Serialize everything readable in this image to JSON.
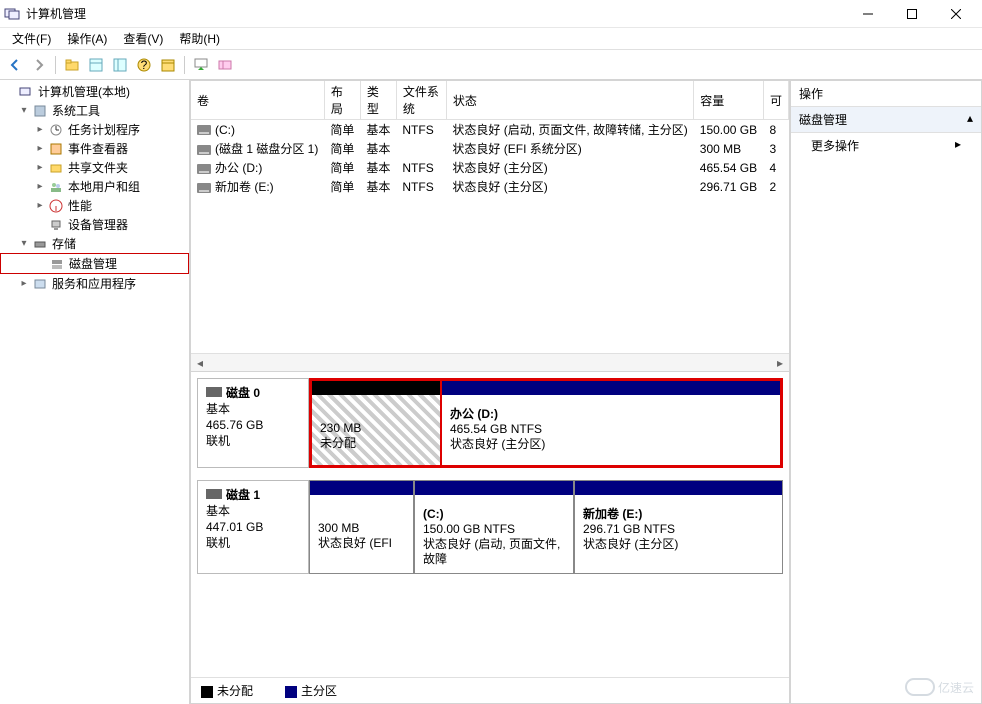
{
  "window": {
    "title": "计算机管理"
  },
  "menu": {
    "file": "文件(F)",
    "action": "操作(A)",
    "view": "查看(V)",
    "help": "帮助(H)"
  },
  "tree": {
    "root": "计算机管理(本地)",
    "system_tools": "系统工具",
    "task_scheduler": "任务计划程序",
    "event_viewer": "事件查看器",
    "shared_folders": "共享文件夹",
    "local_users": "本地用户和组",
    "performance": "性能",
    "device_manager": "设备管理器",
    "storage": "存储",
    "disk_management": "磁盘管理",
    "services_apps": "服务和应用程序"
  },
  "volumes": {
    "headers": {
      "volume": "卷",
      "layout": "布局",
      "type": "类型",
      "filesystem": "文件系统",
      "status": "状态",
      "capacity": "容量",
      "free": "可"
    },
    "rows": [
      {
        "name": "(C:)",
        "layout": "简单",
        "type": "基本",
        "fs": "NTFS",
        "status": "状态良好 (启动, 页面文件, 故障转储, 主分区)",
        "capacity": "150.00 GB",
        "free": "8"
      },
      {
        "name": "(磁盘 1 磁盘分区 1)",
        "layout": "简单",
        "type": "基本",
        "fs": "",
        "status": "状态良好 (EFI 系统分区)",
        "capacity": "300 MB",
        "free": "3"
      },
      {
        "name": "办公 (D:)",
        "layout": "简单",
        "type": "基本",
        "fs": "NTFS",
        "status": "状态良好 (主分区)",
        "capacity": "465.54 GB",
        "free": "4"
      },
      {
        "name": "新加卷 (E:)",
        "layout": "简单",
        "type": "基本",
        "fs": "NTFS",
        "status": "状态良好 (主分区)",
        "capacity": "296.71 GB",
        "free": "2"
      }
    ]
  },
  "disks": {
    "disk0": {
      "title": "磁盘 0",
      "type": "基本",
      "size": "465.76 GB",
      "status": "联机",
      "part1": {
        "size": "230 MB",
        "status": "未分配"
      },
      "part2": {
        "title": "办公  (D:)",
        "size": "465.54 GB NTFS",
        "status": "状态良好 (主分区)"
      }
    },
    "disk1": {
      "title": "磁盘 1",
      "type": "基本",
      "size": "447.01 GB",
      "status": "联机",
      "part1": {
        "size": "300 MB",
        "status": "状态良好 (EFI"
      },
      "part2": {
        "title": "(C:)",
        "size": "150.00 GB NTFS",
        "status": "状态良好 (启动, 页面文件, 故障"
      },
      "part3": {
        "title": "新加卷  (E:)",
        "size": "296.71 GB NTFS",
        "status": "状态良好 (主分区)"
      }
    }
  },
  "legend": {
    "unallocated": "未分配",
    "primary": "主分区"
  },
  "actions": {
    "header": "操作",
    "disk_mgmt": "磁盘管理",
    "more": "更多操作"
  },
  "watermark": "亿速云"
}
